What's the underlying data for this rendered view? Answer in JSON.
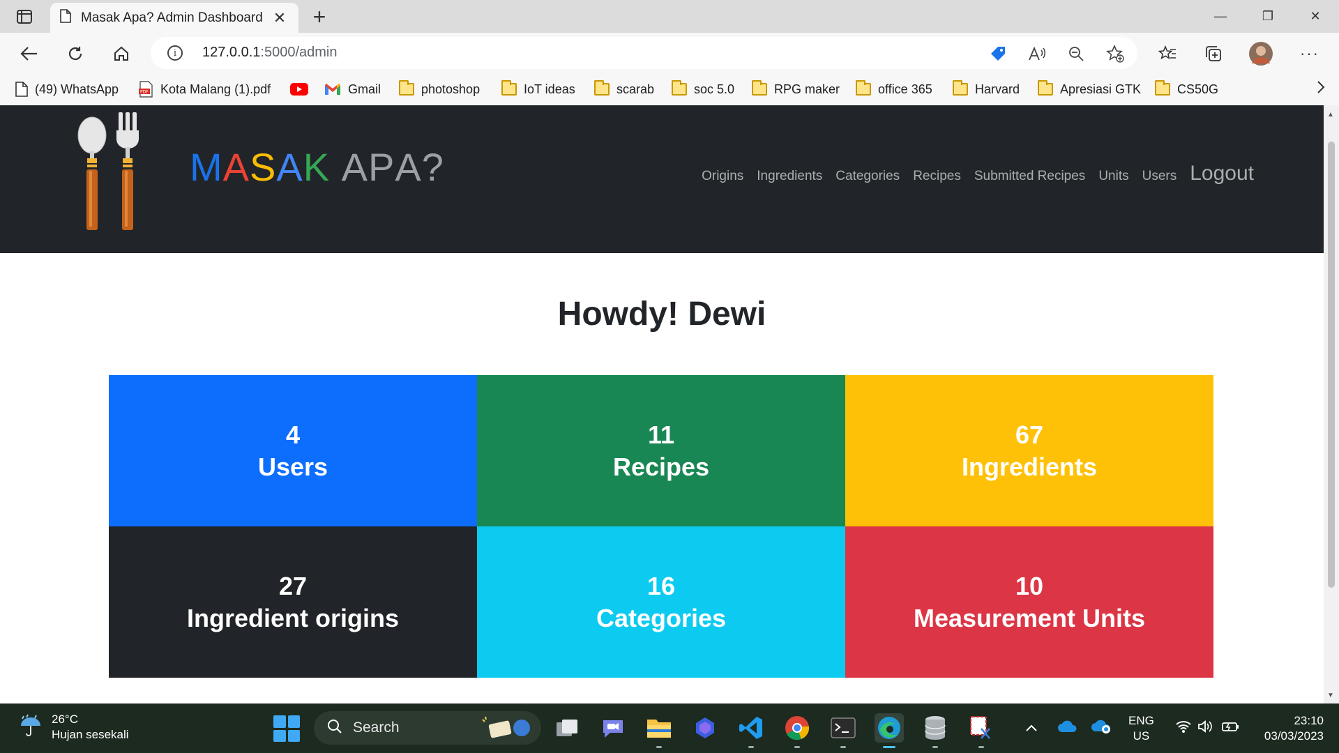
{
  "browser": {
    "tab_title": "Masak Apa? Admin Dashboard",
    "new_tab_symbol": "+",
    "url_host": "127.0.0.1",
    "url_path": ":5000/admin",
    "bookmarks": [
      {
        "label": "(49) WhatsApp",
        "icon": "page-icon"
      },
      {
        "label": "Kota Malang (1).pdf",
        "icon": "pdf-icon"
      },
      {
        "label": "",
        "icon": "youtube-icon"
      },
      {
        "label": "Gmail",
        "icon": "gmail-icon"
      },
      {
        "label": "photoshop",
        "icon": "folder-icon"
      },
      {
        "label": "IoT ideas",
        "icon": "folder-icon"
      },
      {
        "label": "scarab",
        "icon": "folder-icon"
      },
      {
        "label": "soc 5.0",
        "icon": "folder-icon"
      },
      {
        "label": "RPG maker",
        "icon": "folder-icon"
      },
      {
        "label": "office 365",
        "icon": "folder-icon"
      },
      {
        "label": "Harvard",
        "icon": "folder-icon"
      },
      {
        "label": "Apresiasi GTK",
        "icon": "folder-icon"
      },
      {
        "label": "CS50G",
        "icon": "folder-icon"
      }
    ]
  },
  "site": {
    "brand_letters": [
      "M",
      "A",
      "S",
      "A",
      "K",
      " ",
      "A",
      "P",
      "A",
      "?"
    ],
    "brand_colors": [
      "#1a73e8",
      "#ea4335",
      "#fbbc05",
      "#4285f4",
      "#34a853",
      "#888888",
      "#9aa0a6",
      "#9aa0a6",
      "#9aa0a6",
      "#9aa0a6"
    ],
    "nav": {
      "origins": "Origins",
      "ingredients": "Ingredients",
      "categories": "Categories",
      "recipes": "Recipes",
      "submitted": "Submitted Recipes",
      "units": "Units",
      "users": "Users",
      "logout": "Logout"
    },
    "greeting": "Howdy! Dewi"
  },
  "stats": [
    {
      "count": "4",
      "label": "Users",
      "color": "#0d6efd"
    },
    {
      "count": "11",
      "label": "Recipes",
      "color": "#198754"
    },
    {
      "count": "67",
      "label": "Ingredients",
      "color": "#ffc107"
    },
    {
      "count": "27",
      "label": "Ingredient origins",
      "color": "#212529"
    },
    {
      "count": "16",
      "label": "Categories",
      "color": "#0dcaf0"
    },
    {
      "count": "10",
      "label": "Measurement Units",
      "color": "#dc3545"
    }
  ],
  "taskbar": {
    "temperature": "26°C",
    "weather": "Hujan sesekali",
    "search_label": "Search",
    "language_line1": "ENG",
    "language_line2": "US",
    "time": "23:10",
    "date": "03/03/2023"
  }
}
